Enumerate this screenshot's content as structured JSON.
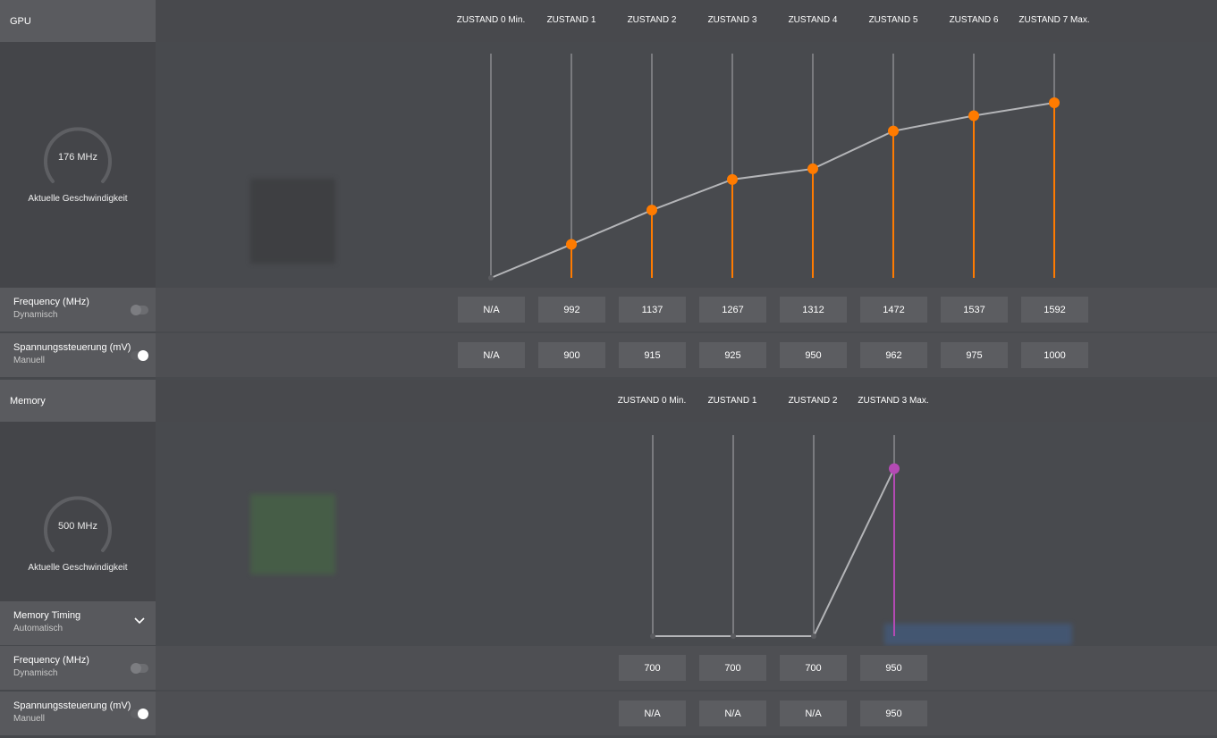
{
  "gpu": {
    "title": "GPU",
    "gauge_value": "176 MHz",
    "gauge_caption": "Aktuelle Geschwindigkeit",
    "states": [
      "ZUSTAND 0 Min.",
      "ZUSTAND 1",
      "ZUSTAND 2",
      "ZUSTAND 3",
      "ZUSTAND 4",
      "ZUSTAND 5",
      "ZUSTAND 6",
      "ZUSTAND 7 Max."
    ],
    "frequency": {
      "label": "Frequency (MHz)",
      "mode": "Dynamisch",
      "toggle": "off",
      "values": [
        "N/A",
        "992",
        "1137",
        "1267",
        "1312",
        "1472",
        "1537",
        "1592"
      ]
    },
    "voltage": {
      "label": "Spannungssteuerung (mV)",
      "mode": "Manuell",
      "toggle": "on",
      "values": [
        "N/A",
        "900",
        "915",
        "925",
        "950",
        "962",
        "975",
        "1000"
      ]
    },
    "curve_color": "#ff7b00"
  },
  "memory": {
    "title": "Memory",
    "gauge_value": "500 MHz",
    "gauge_caption": "Aktuelle Geschwindigkeit",
    "states": [
      "ZUSTAND 0 Min.",
      "ZUSTAND 1",
      "ZUSTAND 2",
      "ZUSTAND 3 Max."
    ],
    "timing": {
      "label": "Memory Timing",
      "mode": "Automatisch"
    },
    "frequency": {
      "label": "Frequency (MHz)",
      "mode": "Dynamisch",
      "toggle": "off",
      "values": [
        "700",
        "700",
        "700",
        "950"
      ]
    },
    "voltage": {
      "label": "Spannungssteuerung (mV)",
      "mode": "Manuell",
      "toggle": "on",
      "values": [
        "N/A",
        "N/A",
        "N/A",
        "950"
      ]
    },
    "curve_color": "#b44ab4"
  }
}
